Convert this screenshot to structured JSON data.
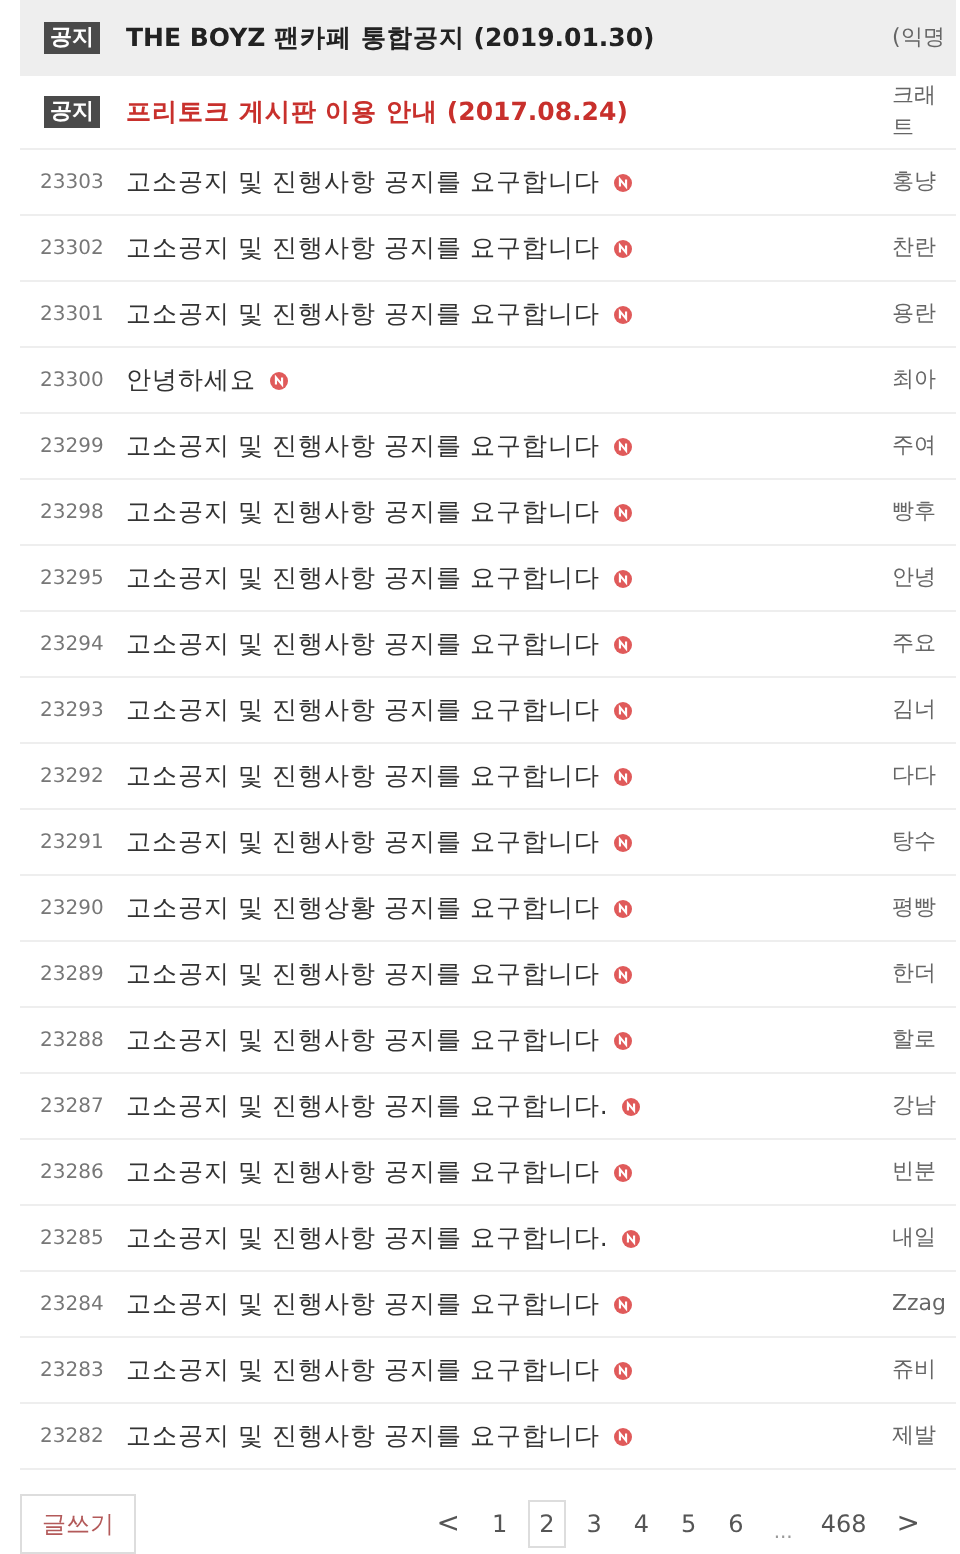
{
  "notices": [
    {
      "badge": "공지",
      "title": "THE BOYZ 팬카페 통합공지 (2019.01.30)",
      "author": "(익명",
      "highlight": false,
      "shaded": true
    },
    {
      "badge": "공지",
      "title": "프리토크 게시판 이용 안내 (2017.08.24)",
      "author": "크래\n트",
      "highlight": true,
      "shaded": false
    }
  ],
  "posts": [
    {
      "number": "23303",
      "title": "고소공지 및 진행사항 공지를 요구합니다",
      "new": true,
      "author": "홍냥"
    },
    {
      "number": "23302",
      "title": "고소공지 및 진행사항 공지를 요구합니다",
      "new": true,
      "author": "찬란"
    },
    {
      "number": "23301",
      "title": "고소공지 및 진행사항 공지를 요구합니다",
      "new": true,
      "author": "용란"
    },
    {
      "number": "23300",
      "title": "안녕하세요",
      "new": true,
      "author": "최아"
    },
    {
      "number": "23299",
      "title": "고소공지 및 진행사항 공지를 요구합니다",
      "new": true,
      "author": "주여"
    },
    {
      "number": "23298",
      "title": "고소공지 및 진행사항 공지를 요구합니다",
      "new": true,
      "author": "빵후"
    },
    {
      "number": "23295",
      "title": "고소공지 및 진행사항 공지를 요구합니다",
      "new": true,
      "author": "안녕"
    },
    {
      "number": "23294",
      "title": "고소공지 및 진행사항 공지를 요구합니다",
      "new": true,
      "author": "주요"
    },
    {
      "number": "23293",
      "title": "고소공지 및 진행사항 공지를 요구합니다",
      "new": true,
      "author": "김너"
    },
    {
      "number": "23292",
      "title": "고소공지 및 진행사항 공지를 요구합니다",
      "new": true,
      "author": "다다"
    },
    {
      "number": "23291",
      "title": "고소공지 및 진행사항 공지를 요구합니다",
      "new": true,
      "author": "탕수"
    },
    {
      "number": "23290",
      "title": "고소공지 및 진행상황 공지를 요구합니다",
      "new": true,
      "author": "평빵"
    },
    {
      "number": "23289",
      "title": "고소공지 및 진행사항 공지를 요구합니다",
      "new": true,
      "author": "한더"
    },
    {
      "number": "23288",
      "title": "고소공지 및 진행사항 공지를 요구합니다",
      "new": true,
      "author": "할로"
    },
    {
      "number": "23287",
      "title": "고소공지 및 진행사항 공지를 요구합니다.",
      "new": true,
      "author": "강남"
    },
    {
      "number": "23286",
      "title": "고소공지 및 진행사항 공지를 요구합니다",
      "new": true,
      "author": "빈분"
    },
    {
      "number": "23285",
      "title": "고소공지 및 진행사항 공지를 요구합니다.",
      "new": true,
      "author": "내일"
    },
    {
      "number": "23284",
      "title": "고소공지 및 진행사항 공지를 요구합니다",
      "new": true,
      "author": "Zzag"
    },
    {
      "number": "23283",
      "title": "고소공지 및 진행사항 공지를 요구합니다",
      "new": true,
      "author": "쥬비"
    },
    {
      "number": "23282",
      "title": "고소공지 및 진행사항 공지를 요구합니다",
      "new": true,
      "author": "제발"
    }
  ],
  "write_button": "글쓰기",
  "pagination": {
    "prev": "<",
    "next": ">",
    "pages": [
      {
        "label": "1",
        "selected": false
      },
      {
        "label": "2",
        "selected": true
      },
      {
        "label": "3",
        "selected": false
      },
      {
        "label": "4",
        "selected": false
      },
      {
        "label": "5",
        "selected": false
      },
      {
        "label": "6",
        "selected": false
      }
    ],
    "ellipsis": "...",
    "last": "468"
  }
}
